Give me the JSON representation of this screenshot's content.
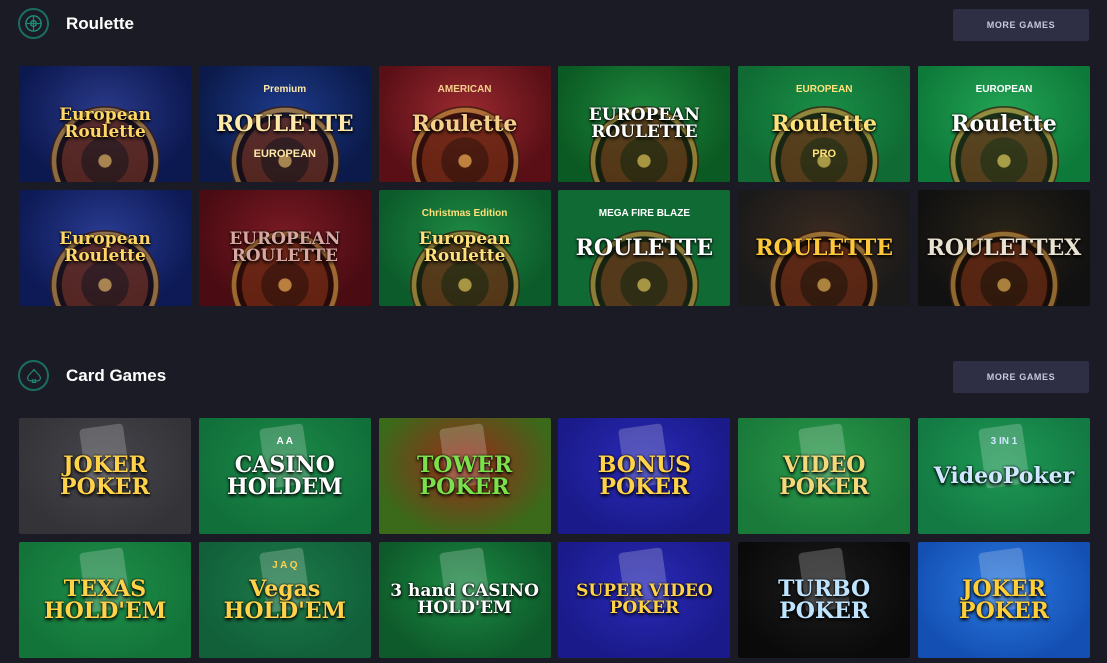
{
  "sections": [
    {
      "title": "Roulette",
      "icon": "roulette-wheel-icon",
      "more_label": "MORE GAMES",
      "games": [
        {
          "label": "European Roulette",
          "bg": "#0c1850",
          "bg2": "#2a3a8a",
          "color": "#ffd766"
        },
        {
          "label": "ROULETTE",
          "sub": "Premium",
          "sub2": "EUROPEAN",
          "bg": "#0b1a4a",
          "bg2": "#1d3a8a",
          "color": "#ffe9a8"
        },
        {
          "label": "Roulette",
          "sub": "AMERICAN",
          "bg": "#5a0f16",
          "bg2": "#9a2a30",
          "color": "#f4d08a"
        },
        {
          "label": "EUROPEAN ROULETTE",
          "bg": "#0b5a23",
          "bg2": "#1f8a3e",
          "color": "#ffffff"
        },
        {
          "label": "Roulette",
          "sub": "EUROPEAN",
          "sub2": "PRO",
          "bg": "#0f6b33",
          "bg2": "#1a8f48",
          "color": "#ffe27a"
        },
        {
          "label": "Roulette",
          "sub": "EUROPEAN",
          "bg": "#0e7a3a",
          "bg2": "#22a454",
          "color": "#ffffff"
        },
        {
          "label": "European Roulette",
          "bg": "#0d1a56",
          "bg2": "#2a3c92",
          "color": "#ffd766"
        },
        {
          "label": "EUROPEAN ROULETTE",
          "bg": "#4a0b12",
          "bg2": "#7a1a24",
          "color": "#d9a7a0"
        },
        {
          "label": "European Roulette",
          "sub": "Christmas Edition",
          "bg": "#0c5b2a",
          "bg2": "#1e8a44",
          "color": "#ffe07a"
        },
        {
          "label": "ROULETTE",
          "sub": "MEGA FIRE BLAZE",
          "bg": "#0f6b33",
          "bg2": "#0f6b33",
          "color": "#ffffff"
        },
        {
          "label": "ROULETTE",
          "bg": "#1a1a1a",
          "bg2": "#3a2a20",
          "color": "#ffc83a"
        },
        {
          "label": "ROULETTEX",
          "bg": "#111111",
          "bg2": "#2a2418",
          "color": "#e9e2d0"
        }
      ]
    },
    {
      "title": "Card Games",
      "icon": "spade-icon",
      "more_label": "MORE GAMES",
      "games": [
        {
          "label": "JOKER POKER",
          "bg": "#333338",
          "bg2": "#46464c",
          "color": "#ffd24a"
        },
        {
          "label": "CASINO HOLDEM",
          "sub": "A A",
          "bg": "#11703a",
          "bg2": "#1c8a48",
          "color": "#ffffff"
        },
        {
          "label": "TOWER POKER",
          "bg": "#3a6a1a",
          "bg2": "#9a2a1a",
          "color": "#7be04a"
        },
        {
          "label": "BONUS POKER",
          "bg": "#1a1a8a",
          "bg2": "#2a2ab8",
          "color": "#ffd24a"
        },
        {
          "label": "VIDEO POKER",
          "bg": "#1a7a3a",
          "bg2": "#2a9a4a",
          "color": "#f4d97a"
        },
        {
          "label": "VideoPoker",
          "sub": "3 IN 1",
          "bg": "#137a43",
          "bg2": "#1e9a55",
          "color": "#cfe7ff"
        },
        {
          "label": "TEXAS HOLD'EM",
          "bg": "#13743a",
          "bg2": "#1e8f48",
          "color": "#ffd24a"
        },
        {
          "label": "Vegas HOLD'EM",
          "sub": "J A Q",
          "bg": "#11603a",
          "bg2": "#1c7a48",
          "color": "#ffd24a"
        },
        {
          "label": "3 hand CASINO HOLD'EM",
          "bg": "#0e5a2a",
          "bg2": "#1b8a44",
          "color": "#ffffff"
        },
        {
          "label": "SUPER VIDEO POKER",
          "bg": "#1a1a8a",
          "bg2": "#2a2ab8",
          "color": "#ffd24a"
        },
        {
          "label": "TURBO POKER",
          "bg": "#0a0a0a",
          "bg2": "#1c1c1c",
          "color": "#bfe4ff"
        },
        {
          "label": "JOKER POKER",
          "bg": "#1450b4",
          "bg2": "#2a7ae0",
          "color": "#ffcf3a"
        }
      ]
    }
  ]
}
